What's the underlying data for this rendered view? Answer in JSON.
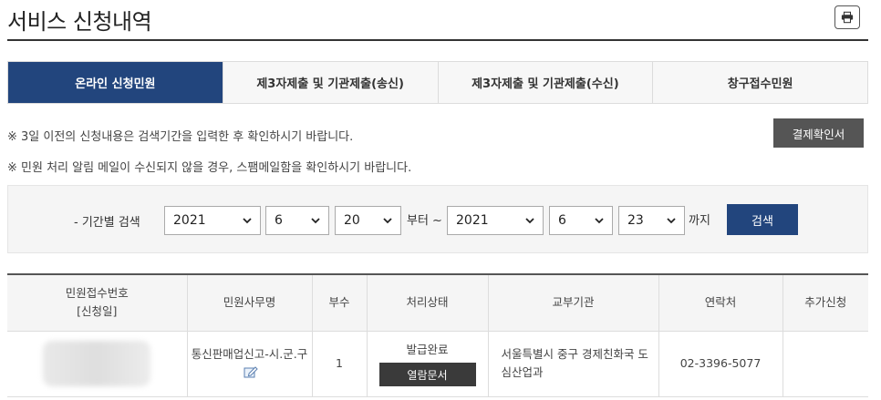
{
  "header": {
    "title": "서비스 신청내역",
    "print_icon": "printer-icon"
  },
  "tabs": [
    {
      "label": "온라인 신청민원",
      "active": true
    },
    {
      "label": "제3자제출 및 기관제출(송신)",
      "active": false
    },
    {
      "label": "제3자제출 및 기관제출(수신)",
      "active": false
    },
    {
      "label": "창구접수민원",
      "active": false
    }
  ],
  "notices": [
    "※ 3일 이전의 신청내용은 검색기간을 입력한 후 확인하시기 바랍니다.",
    "※ 민원 처리 알림 메일이 수신되지 않을 경우, 스팸메일함을 확인하시기 바랍니다."
  ],
  "buttons": {
    "payment_confirmation": "결제확인서",
    "search": "검색"
  },
  "search": {
    "label": "- 기간별 검색",
    "from": {
      "year": "2021",
      "month": "6",
      "day": "20"
    },
    "to": {
      "year": "2021",
      "month": "6",
      "day": "23"
    },
    "from_suffix": "부터 ~",
    "to_suffix": "까지"
  },
  "table": {
    "headers": {
      "receipt_no": "민원접수번호",
      "receipt_date": "[신청일]",
      "service_name": "민원사무명",
      "copies": "부수",
      "status": "처리상태",
      "agency": "교부기관",
      "contact": "연락처",
      "additional": "추가신청"
    },
    "rows": [
      {
        "service_name": "통신판매업신고-시.군.구",
        "copies": "1",
        "status": "발급완료",
        "view_button": "열람문서",
        "agency": "서울특별시 중구 경제친화국 도심산업과",
        "contact": "02-3396-5077",
        "additional": ""
      }
    ]
  },
  "colors": {
    "primary": "#22457d",
    "dark_button": "#555555"
  }
}
